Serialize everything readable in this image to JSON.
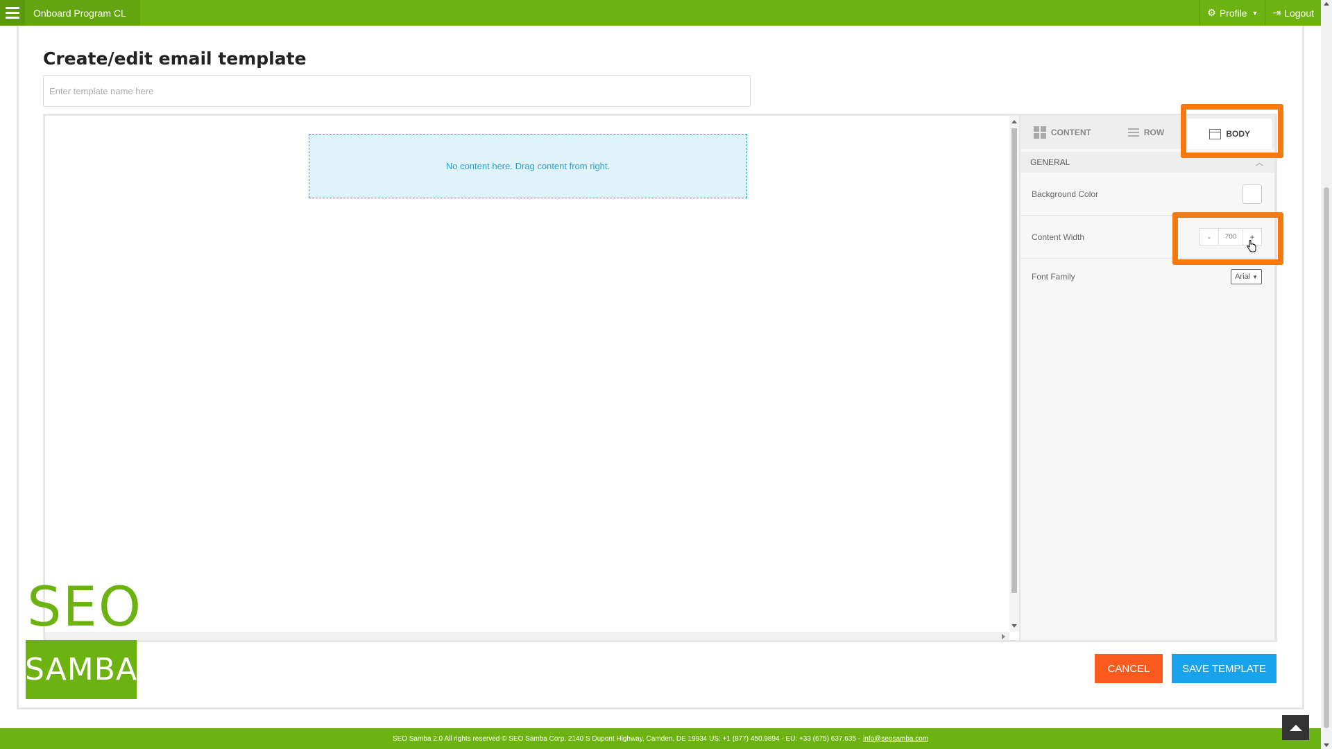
{
  "topbar": {
    "breadcrumb": "Onboard Program CL",
    "profile_label": "Profile",
    "logout_label": "Logout",
    "menu_icon": "hamburger-icon",
    "profile_icon": "gear-icon",
    "logout_icon": "sign-out-icon"
  },
  "page": {
    "title": "Create/edit email template",
    "name_placeholder": "Enter template name here",
    "name_value": ""
  },
  "canvas": {
    "dropzone_text": "No content here. Drag content from right."
  },
  "panel": {
    "tabs": [
      {
        "label": "CONTENT",
        "icon": "grid-icon",
        "active": false
      },
      {
        "label": "ROW",
        "icon": "rows-icon",
        "active": false
      },
      {
        "label": "BODY",
        "icon": "window-icon",
        "active": true
      }
    ],
    "section": "GENERAL",
    "props": {
      "background_color_label": "Background Color",
      "background_color_value": "#ffffff",
      "content_width_label": "Content Width",
      "content_width_value": "700",
      "decrement": "-",
      "increment": "+",
      "font_family_label": "Font Family",
      "font_family_value": "Arial"
    }
  },
  "actions": {
    "cancel": "CANCEL",
    "save": "SAVE TEMPLATE"
  },
  "logo": {
    "line1": "SEO",
    "line2": "SAMBA"
  },
  "footer": {
    "text": "SEO Samba 2.0  All rights reserved © SEO Samba Corp. 2140 S Dupont Highway, Camden, DE 19934 US: +1 (877) 450.9894 - EU: +33 (675) 637.635 -",
    "email": "info@seosamba.com"
  },
  "colors": {
    "brand_green": "#6cb312",
    "highlight_orange": "#f47a0f",
    "cancel_red": "#fb5a1e",
    "save_blue": "#19a3ec"
  }
}
